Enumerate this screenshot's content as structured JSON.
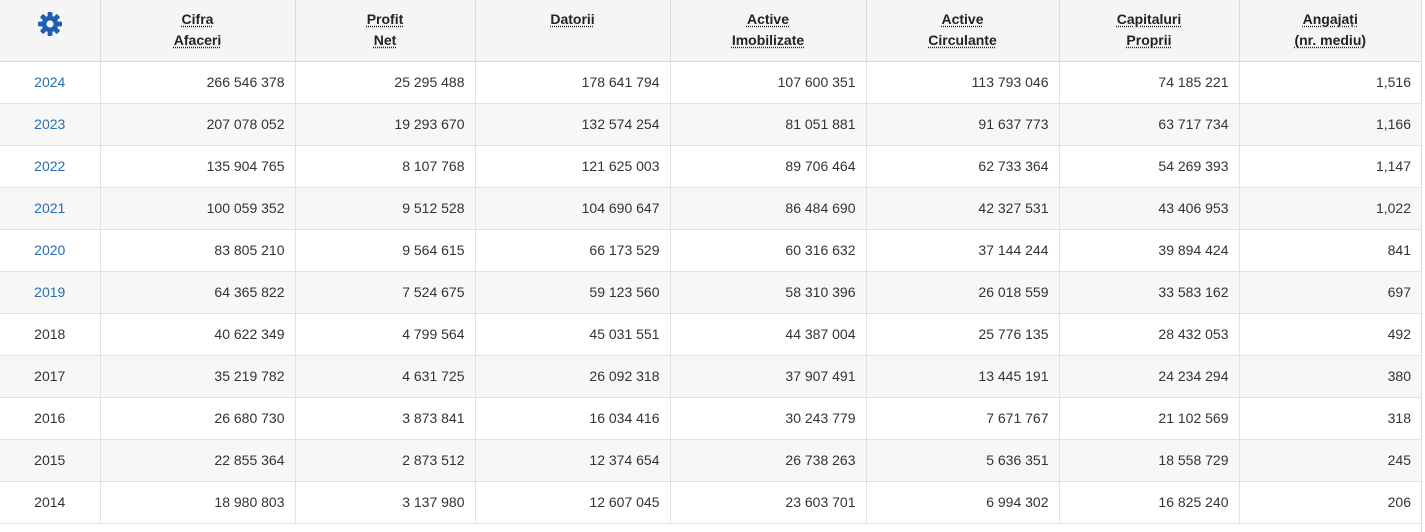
{
  "table": {
    "settings_icon": "gear-icon",
    "accent_color": "#1f5fb0",
    "link_color": "#2a6db0",
    "headers": [
      {
        "line1": "Cifra",
        "line2": "Afaceri"
      },
      {
        "line1": "Profit",
        "line2": "Net"
      },
      {
        "line1": "Datorii",
        "line2": ""
      },
      {
        "line1": "Active",
        "line2": "Imobilizate"
      },
      {
        "line1": "Active",
        "line2": "Circulante"
      },
      {
        "line1": "Capitaluri",
        "line2": "Proprii"
      },
      {
        "line1": "Angajați",
        "line2": "(nr. mediu)"
      }
    ],
    "rows": [
      {
        "year": "2024",
        "is_link": true,
        "cifra_afaceri": "266 546 378",
        "profit_net": "25 295 488",
        "datorii": "178 641 794",
        "active_imobilizate": "107 600 351",
        "active_circulante": "113 793 046",
        "capitaluri_proprii": "74 185 221",
        "angajati": "1,516"
      },
      {
        "year": "2023",
        "is_link": true,
        "cifra_afaceri": "207 078 052",
        "profit_net": "19 293 670",
        "datorii": "132 574 254",
        "active_imobilizate": "81 051 881",
        "active_circulante": "91 637 773",
        "capitaluri_proprii": "63 717 734",
        "angajati": "1,166"
      },
      {
        "year": "2022",
        "is_link": true,
        "cifra_afaceri": "135 904 765",
        "profit_net": "8 107 768",
        "datorii": "121 625 003",
        "active_imobilizate": "89 706 464",
        "active_circulante": "62 733 364",
        "capitaluri_proprii": "54 269 393",
        "angajati": "1,147"
      },
      {
        "year": "2021",
        "is_link": true,
        "cifra_afaceri": "100 059 352",
        "profit_net": "9 512 528",
        "datorii": "104 690 647",
        "active_imobilizate": "86 484 690",
        "active_circulante": "42 327 531",
        "capitaluri_proprii": "43 406 953",
        "angajati": "1,022"
      },
      {
        "year": "2020",
        "is_link": true,
        "cifra_afaceri": "83 805 210",
        "profit_net": "9 564 615",
        "datorii": "66 173 529",
        "active_imobilizate": "60 316 632",
        "active_circulante": "37 144 244",
        "capitaluri_proprii": "39 894 424",
        "angajati": "841"
      },
      {
        "year": "2019",
        "is_link": true,
        "cifra_afaceri": "64 365 822",
        "profit_net": "7 524 675",
        "datorii": "59 123 560",
        "active_imobilizate": "58 310 396",
        "active_circulante": "26 018 559",
        "capitaluri_proprii": "33 583 162",
        "angajati": "697"
      },
      {
        "year": "2018",
        "is_link": false,
        "cifra_afaceri": "40 622 349",
        "profit_net": "4 799 564",
        "datorii": "45 031 551",
        "active_imobilizate": "44 387 004",
        "active_circulante": "25 776 135",
        "capitaluri_proprii": "28 432 053",
        "angajati": "492"
      },
      {
        "year": "2017",
        "is_link": false,
        "cifra_afaceri": "35 219 782",
        "profit_net": "4 631 725",
        "datorii": "26 092 318",
        "active_imobilizate": "37 907 491",
        "active_circulante": "13 445 191",
        "capitaluri_proprii": "24 234 294",
        "angajati": "380"
      },
      {
        "year": "2016",
        "is_link": false,
        "cifra_afaceri": "26 680 730",
        "profit_net": "3 873 841",
        "datorii": "16 034 416",
        "active_imobilizate": "30 243 779",
        "active_circulante": "7 671 767",
        "capitaluri_proprii": "21 102 569",
        "angajati": "318"
      },
      {
        "year": "2015",
        "is_link": false,
        "cifra_afaceri": "22 855 364",
        "profit_net": "2 873 512",
        "datorii": "12 374 654",
        "active_imobilizate": "26 738 263",
        "active_circulante": "5 636 351",
        "capitaluri_proprii": "18 558 729",
        "angajati": "245"
      },
      {
        "year": "2014",
        "is_link": false,
        "cifra_afaceri": "18 980 803",
        "profit_net": "3 137 980",
        "datorii": "12 607 045",
        "active_imobilizate": "23 603 701",
        "active_circulante": "6 994 302",
        "capitaluri_proprii": "16 825 240",
        "angajati": "206"
      }
    ]
  }
}
